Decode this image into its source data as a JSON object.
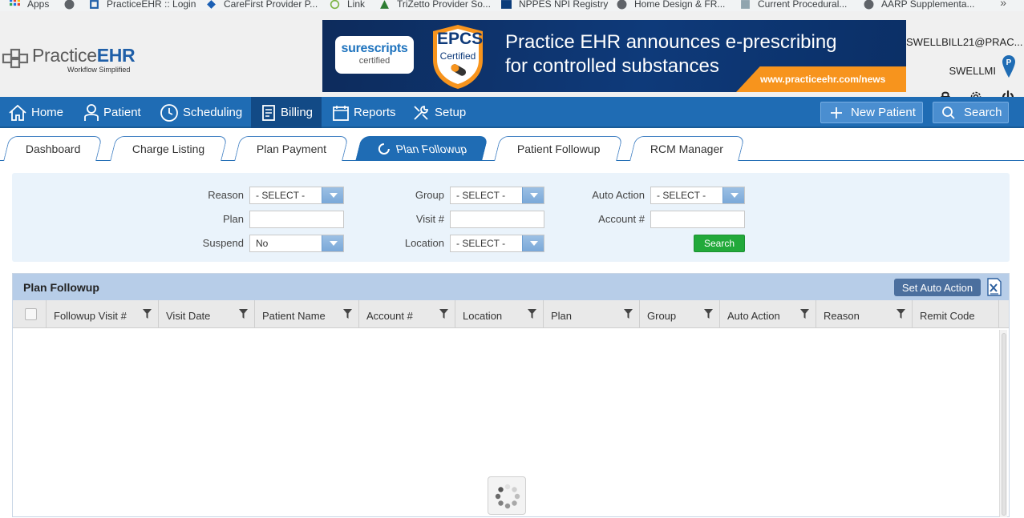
{
  "bookmarks": [
    {
      "label": "Apps",
      "icon": "apps-grid-icon"
    },
    {
      "label": "PracticeEHR :: Login",
      "icon": "practiceehr-icon"
    },
    {
      "label": "CareFirst Provider P...",
      "icon": "carefirst-icon"
    },
    {
      "label": "Link",
      "icon": "link-icon"
    },
    {
      "label": "TriZetto Provider So...",
      "icon": "trizetto-icon"
    },
    {
      "label": "NPPES NPI Registry",
      "icon": "nppes-icon"
    },
    {
      "label": "Home Design & FR...",
      "icon": "globe-icon"
    },
    {
      "label": "Current Procedural...",
      "icon": "document-icon"
    },
    {
      "label": "AARP Supplementa...",
      "icon": "globe-icon"
    }
  ],
  "bookmarks_more": "»",
  "logo": {
    "name_plain": "Practice",
    "name_bold": "EHR",
    "tagline": "Workflow Simplified"
  },
  "banner": {
    "surescripts": "surescripts",
    "surescripts_sub": "certified",
    "epcs": "EPCS",
    "epcs_sub": "Certified",
    "headline_1": "Practice EHR announces e-prescribing",
    "headline_2": "for controlled substances",
    "url": "www.practiceehr.com/news"
  },
  "user": {
    "email": "SWELLBILL21@PRAC...",
    "name": "SWELLMI",
    "pin_letter": "P"
  },
  "nav": {
    "items": [
      {
        "label": "Home",
        "icon": "home-icon"
      },
      {
        "label": "Patient",
        "icon": "user-icon"
      },
      {
        "label": "Scheduling",
        "icon": "clock-icon"
      },
      {
        "label": "Billing",
        "icon": "invoice-icon",
        "active": true
      },
      {
        "label": "Reports",
        "icon": "calendar-icon"
      },
      {
        "label": "Setup",
        "icon": "tools-icon"
      }
    ],
    "new_patient": "New Patient",
    "search": "Search"
  },
  "tabs": [
    {
      "label": "Dashboard"
    },
    {
      "label": "Charge Listing"
    },
    {
      "label": "Plan Payment"
    },
    {
      "label": "Plan Followup",
      "active": true
    },
    {
      "label": "Patient Followup"
    },
    {
      "label": "RCM Manager"
    }
  ],
  "filters": {
    "reason": {
      "label": "Reason",
      "value": "- SELECT -"
    },
    "plan": {
      "label": "Plan",
      "value": ""
    },
    "suspend": {
      "label": "Suspend",
      "value": "No"
    },
    "group": {
      "label": "Group",
      "value": "- SELECT -"
    },
    "visit": {
      "label": "Visit #",
      "value": ""
    },
    "location": {
      "label": "Location",
      "value": "- SELECT -"
    },
    "auto_action": {
      "label": "Auto Action",
      "value": "- SELECT -"
    },
    "account": {
      "label": "Account #",
      "value": ""
    },
    "search_button": "Search"
  },
  "grid": {
    "title": "Plan Followup",
    "set_auto_action": "Set Auto Action",
    "columns": [
      "Followup Visit #",
      "Visit Date",
      "Patient Name",
      "Account #",
      "Location",
      "Plan",
      "Group",
      "Auto Action",
      "Reason",
      "Remit Code"
    ],
    "rows": []
  },
  "colors": {
    "nav_blue": "#1f6cb4",
    "nav_active": "#124a86",
    "grid_header": "#b7cde8",
    "search_green": "#22a93a",
    "accent_orange": "#f7941d"
  }
}
